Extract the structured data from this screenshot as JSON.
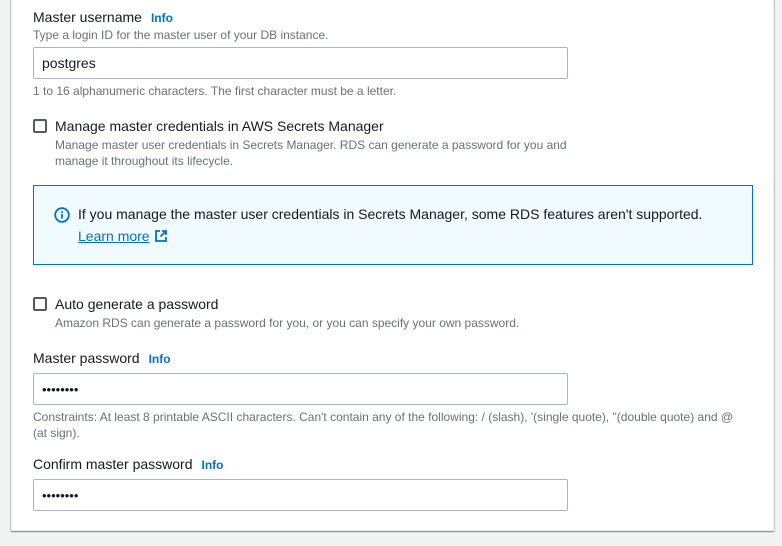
{
  "master_username": {
    "label": "Master username",
    "info": "Info",
    "description": "Type a login ID for the master user of your DB instance.",
    "value": "postgres",
    "constraint": "1 to 16 alphanumeric characters. The first character must be a letter."
  },
  "secrets_manager": {
    "label": "Manage master credentials in AWS Secrets Manager",
    "description_line1": "Manage master user credentials in Secrets Manager. RDS can generate a password for you and",
    "description_line2": "manage it throughout its lifecycle.",
    "checked": false
  },
  "alert": {
    "icon": "info-circle-icon",
    "text": "If you manage the master user credentials in Secrets Manager, some RDS features aren't supported.",
    "link_text": "Learn more",
    "link_icon": "external-link-icon",
    "color": "#0073bb"
  },
  "auto_generate": {
    "label": "Auto generate a password",
    "description": "Amazon RDS can generate a password for you, or you can specify your own password.",
    "checked": false
  },
  "master_password": {
    "label": "Master password",
    "info": "Info",
    "value": "••••••••",
    "constraint_line1": "Constraints: At least 8 printable ASCII characters. Can't contain any of the following: / (slash), '(single quote), \"(double quote) and @",
    "constraint_line2": "(at sign)."
  },
  "confirm_password": {
    "label": "Confirm master password",
    "info": "Info",
    "value": "••••••••"
  }
}
